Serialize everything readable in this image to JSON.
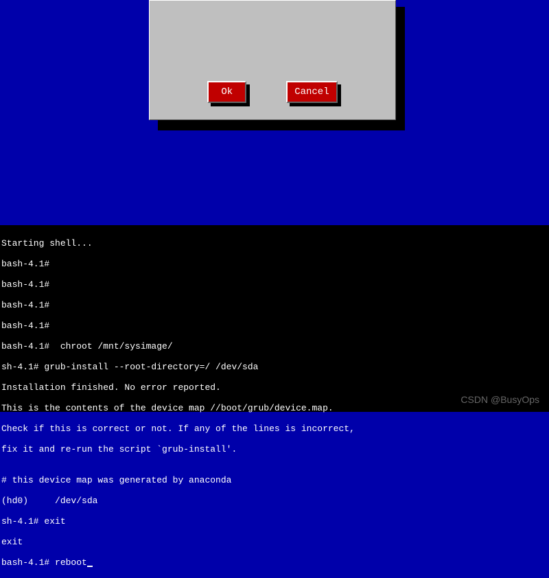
{
  "dialog": {
    "ok_label": "Ok",
    "cancel_label": "Cancel"
  },
  "terminal": {
    "lines": [
      "Starting shell...",
      "bash-4.1#",
      "bash-4.1#",
      "bash-4.1#",
      "bash-4.1#",
      "bash-4.1#  chroot /mnt/sysimage/",
      "sh-4.1# grub-install --root-directory=/ /dev/sda",
      "Installation finished. No error reported.",
      "This is the contents of the device map //boot/grub/device.map.",
      "Check if this is correct or not. If any of the lines is incorrect,",
      "fix it and re-run the script `grub-install'.",
      "",
      "# this device map was generated by anaconda",
      "(hd0)     /dev/sda",
      "sh-4.1# exit",
      "exit",
      "bash-4.1# reboot"
    ]
  },
  "watermark": "CSDN @BusyOps"
}
